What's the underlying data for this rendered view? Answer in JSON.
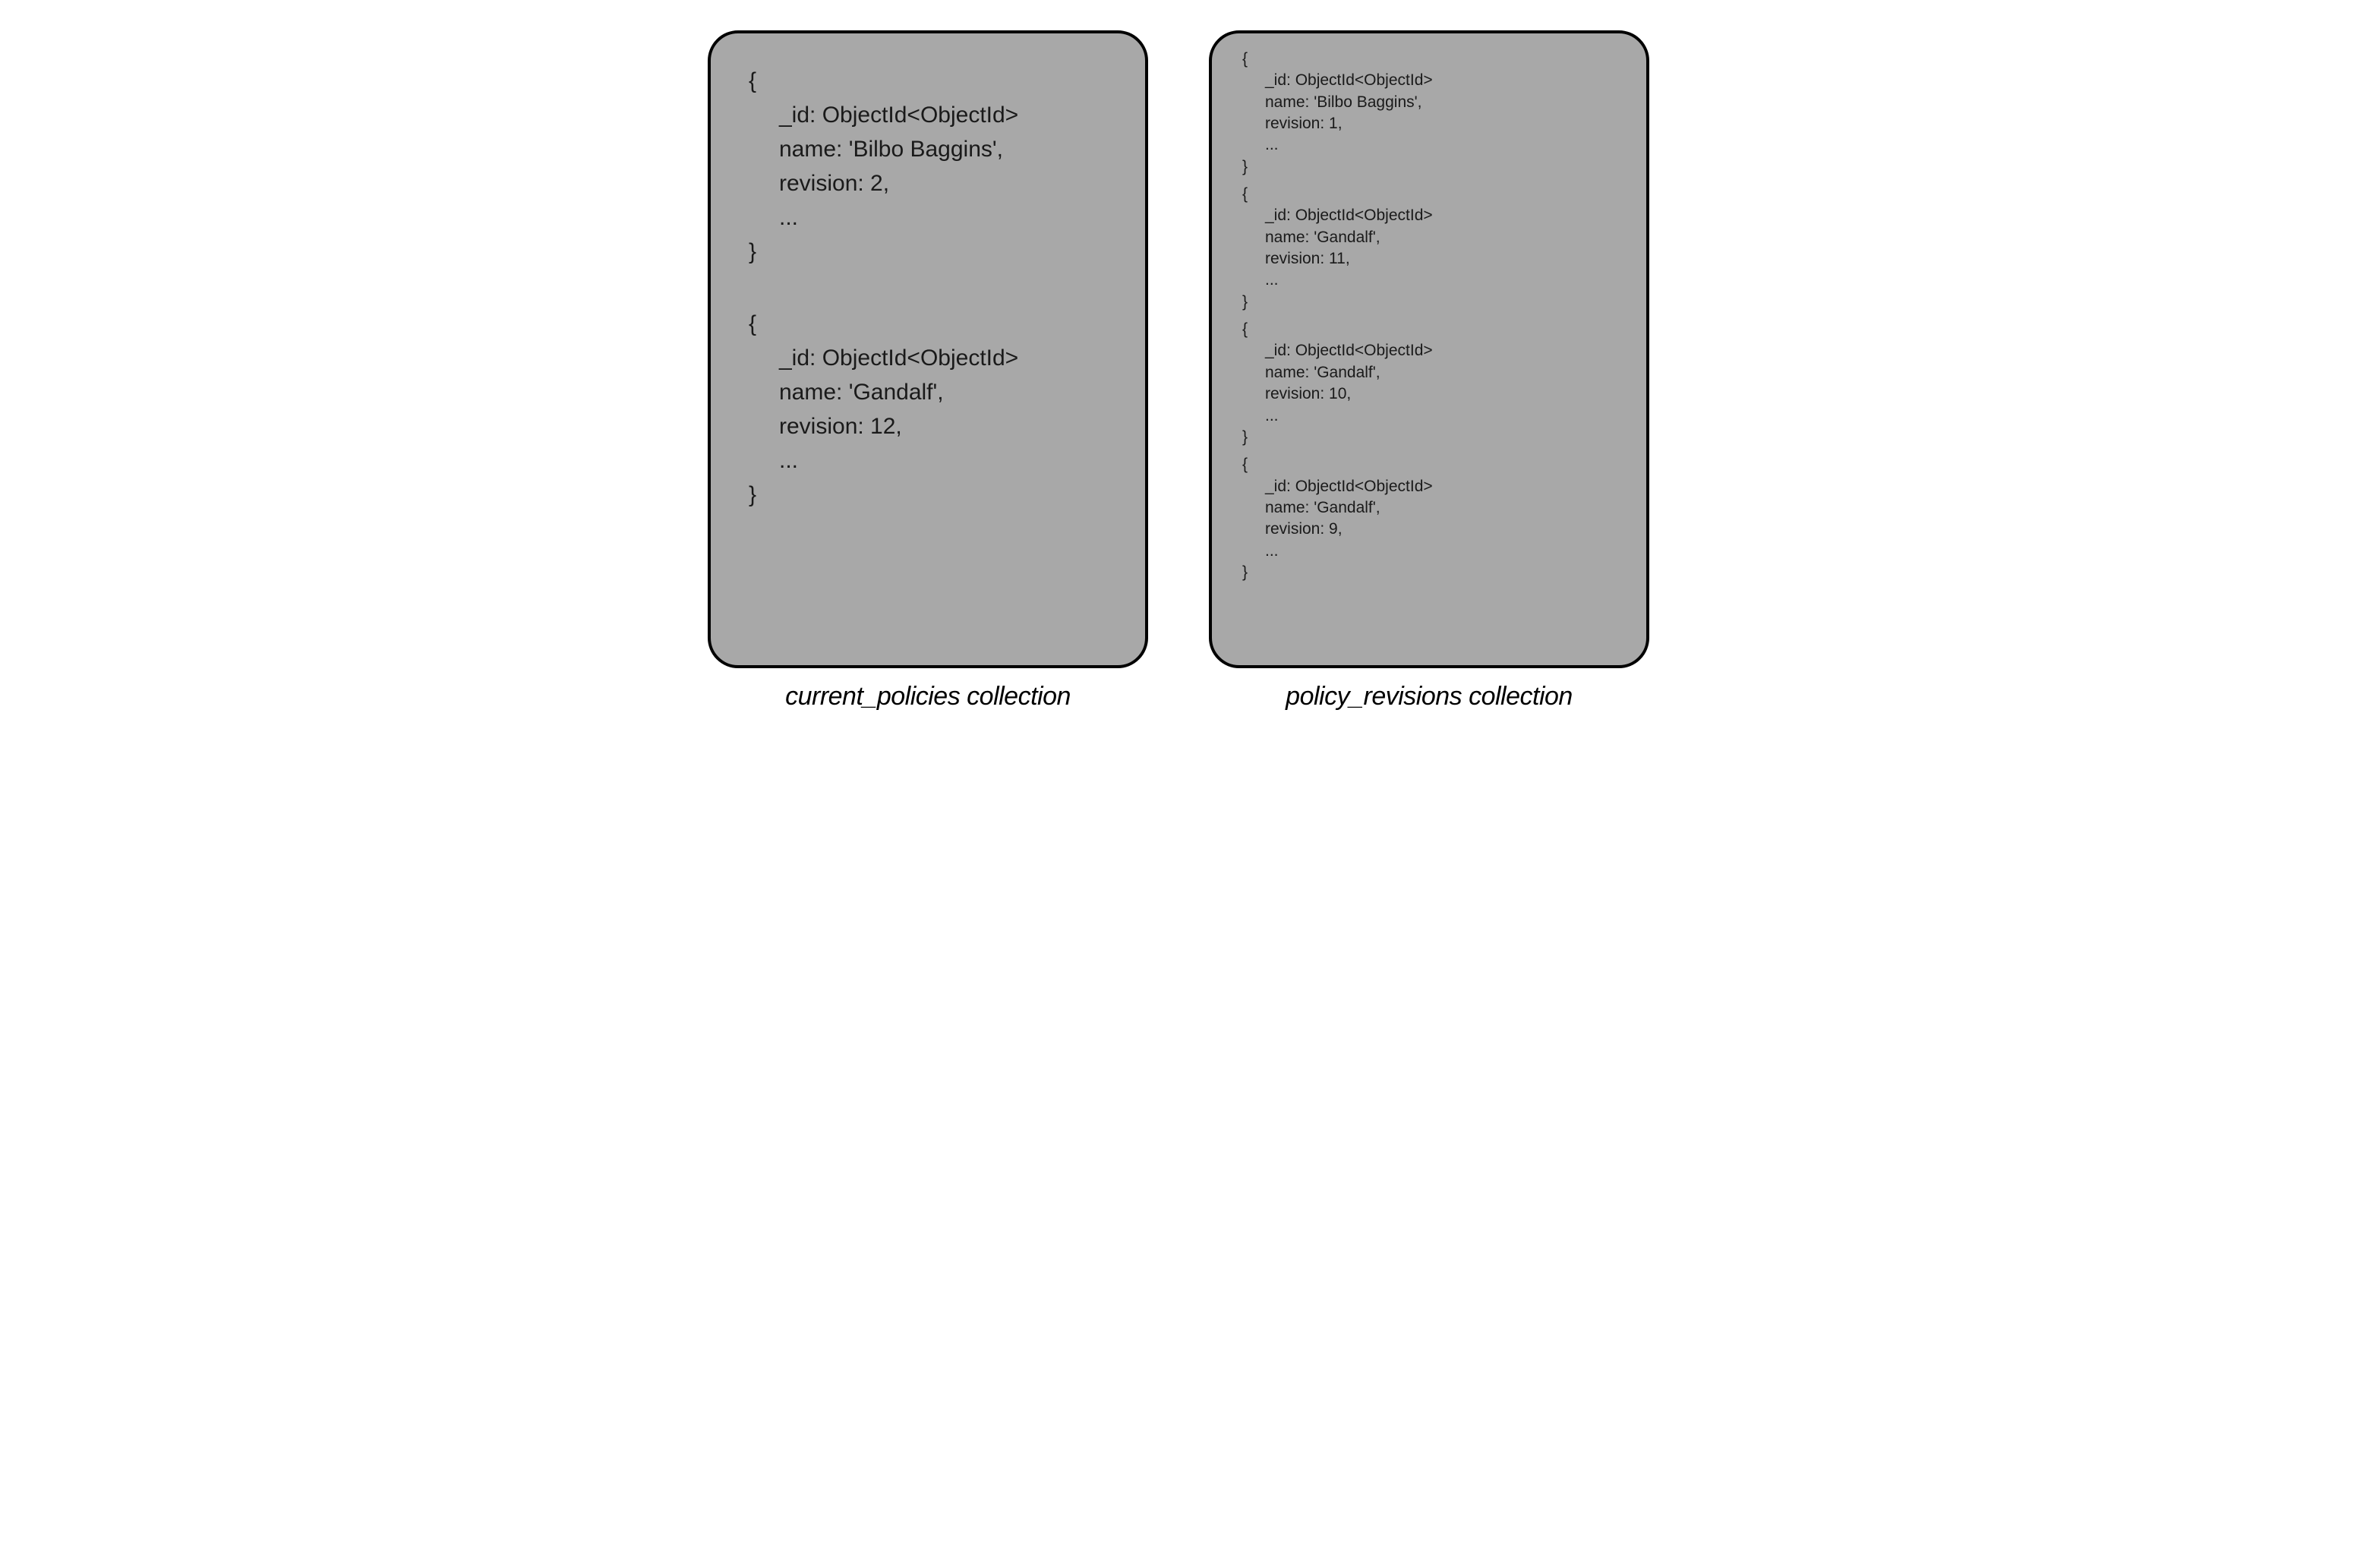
{
  "left": {
    "caption": "current_policies collection",
    "docs": [
      {
        "open": "{",
        "id": "_id: ObjectId<ObjectId>",
        "name": "name: 'Bilbo Baggins',",
        "rev": "revision: 2,",
        "more": "...",
        "close": "}"
      },
      {
        "open": "{",
        "id": "_id: ObjectId<ObjectId>",
        "name": "name: 'Gandalf',",
        "rev": "revision: 12,",
        "more": "...",
        "close": "}"
      }
    ]
  },
  "right": {
    "caption": "policy_revisions collection",
    "docs": [
      {
        "open": "{",
        "id": "_id: ObjectId<ObjectId>",
        "name": "name: 'Bilbo Baggins',",
        "rev": "revision: 1,",
        "more": "...",
        "close": "}"
      },
      {
        "open": "{",
        "id": "_id: ObjectId<ObjectId>",
        "name": "name: 'Gandalf',",
        "rev": "revision: 11,",
        "more": "...",
        "close": "}"
      },
      {
        "open": "{",
        "id": "_id: ObjectId<ObjectId>",
        "name": "name: 'Gandalf',",
        "rev": "revision: 10,",
        "more": "...",
        "close": "}"
      },
      {
        "open": "{",
        "id": "_id: ObjectId<ObjectId>",
        "name": "name: 'Gandalf',",
        "rev": "revision: 9,",
        "more": "...",
        "close": "}"
      }
    ]
  }
}
